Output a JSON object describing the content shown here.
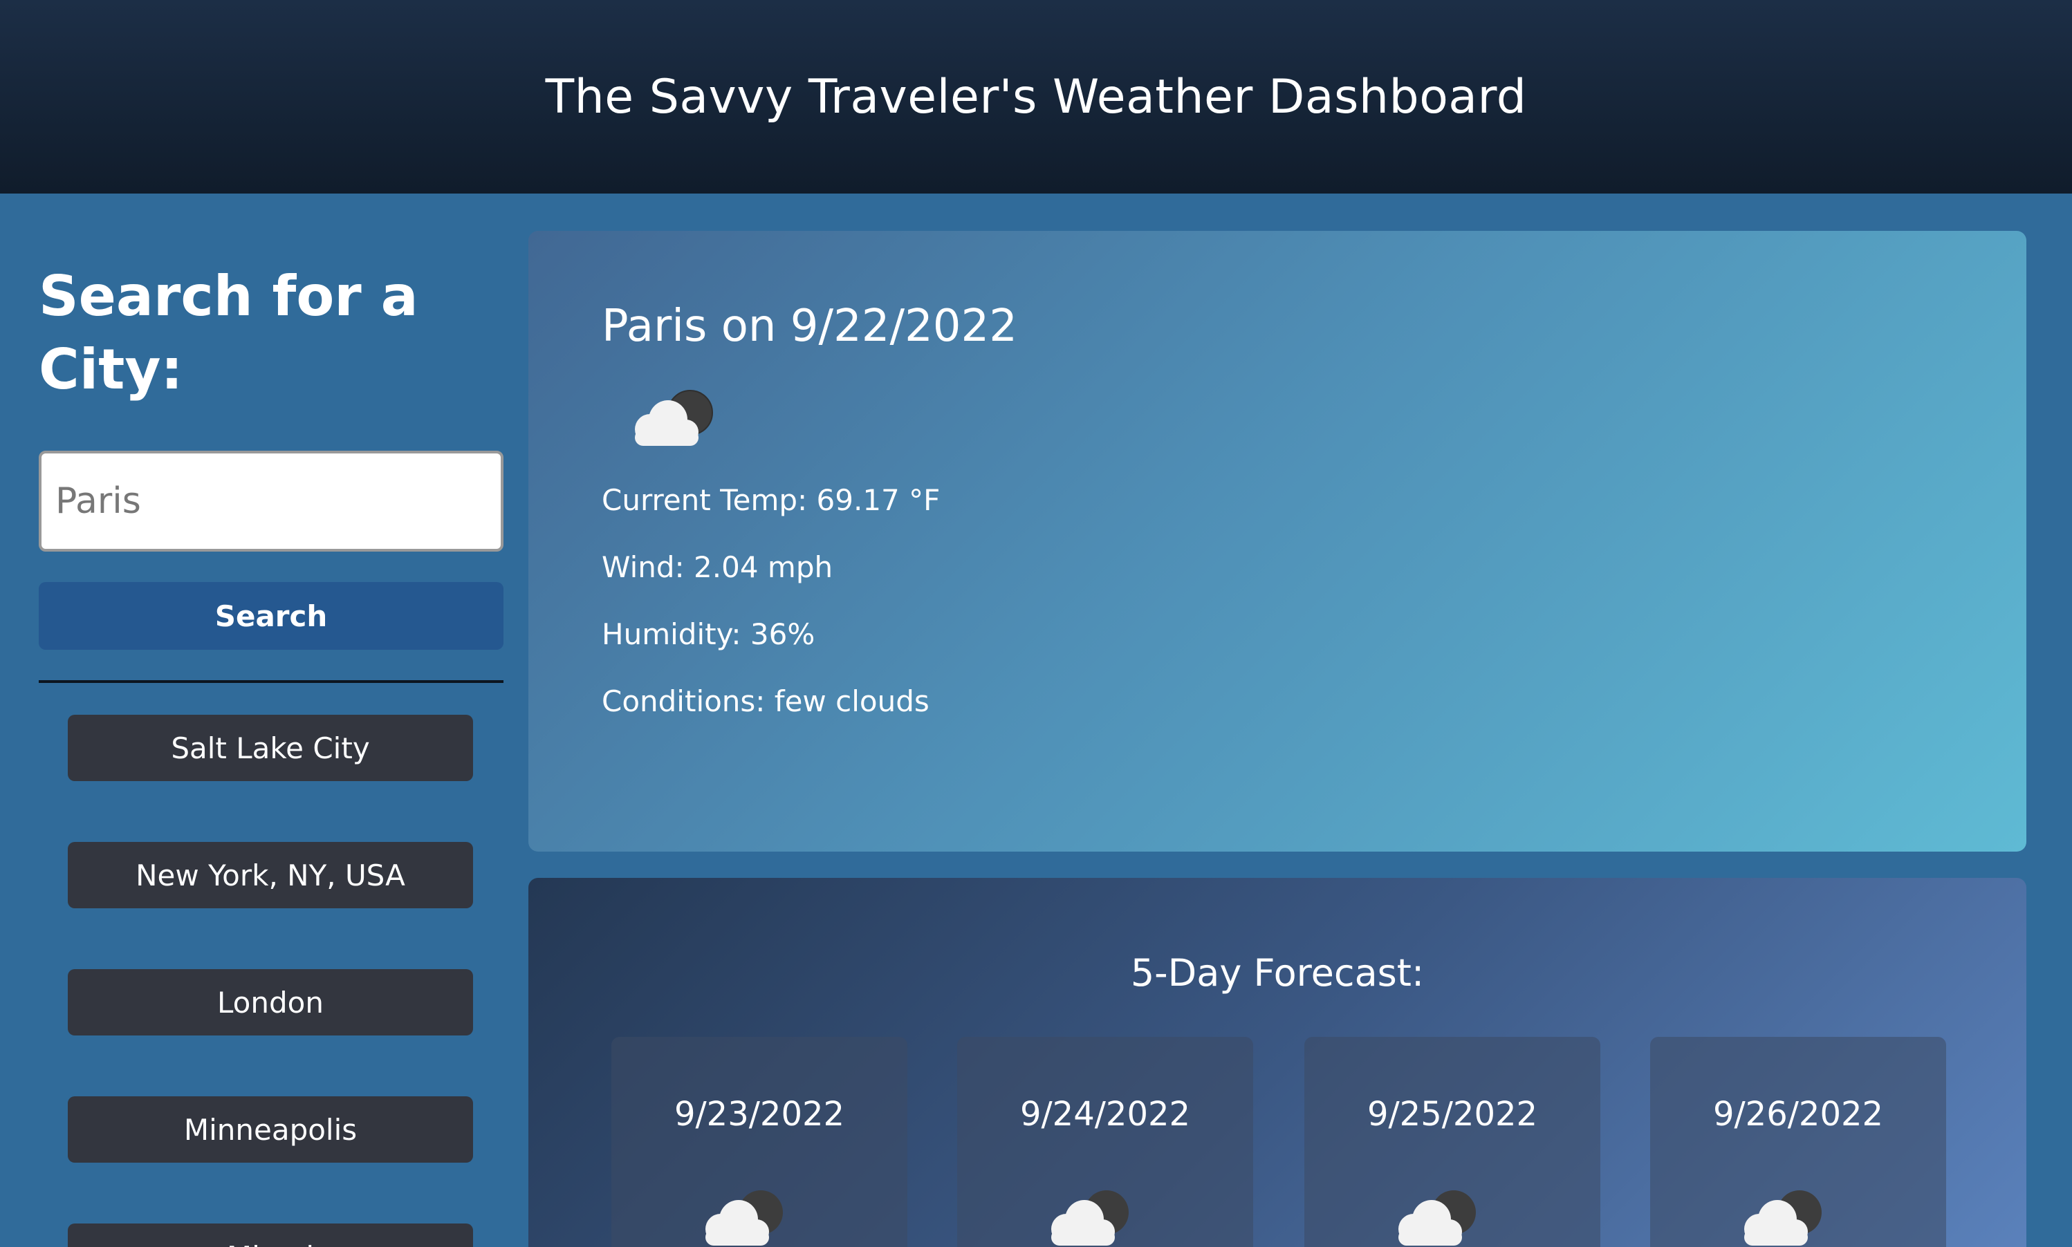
{
  "header": {
    "title": "The Savvy Traveler's Weather Dashboard"
  },
  "sidebar": {
    "heading": "Search for a City:",
    "input_value": "",
    "input_placeholder": "Paris",
    "search_label": "Search",
    "history": [
      "Salt Lake City",
      "New York, NY, USA",
      "London",
      "Minneapolis",
      "Miami"
    ]
  },
  "current": {
    "title": "Paris on 9/22/2022",
    "icon": "few-clouds-night-icon",
    "temp": "Current Temp: 69.17 °F",
    "wind": "Wind: 2.04 mph",
    "humidity": "Humidity: 36%",
    "conditions": "Conditions: few clouds"
  },
  "forecast": {
    "title": "5-Day Forecast:",
    "days": [
      {
        "date": "9/23/2022",
        "icon": "few-clouds-night-icon"
      },
      {
        "date": "9/24/2022",
        "icon": "few-clouds-night-icon"
      },
      {
        "date": "9/25/2022",
        "icon": "few-clouds-night-icon"
      },
      {
        "date": "9/26/2022",
        "icon": "few-clouds-night-icon"
      }
    ]
  },
  "colors": {
    "page_bg": "#306b9a",
    "header_bg": "#101c2b",
    "search_button": "#255890",
    "history_button": "#33363f"
  }
}
